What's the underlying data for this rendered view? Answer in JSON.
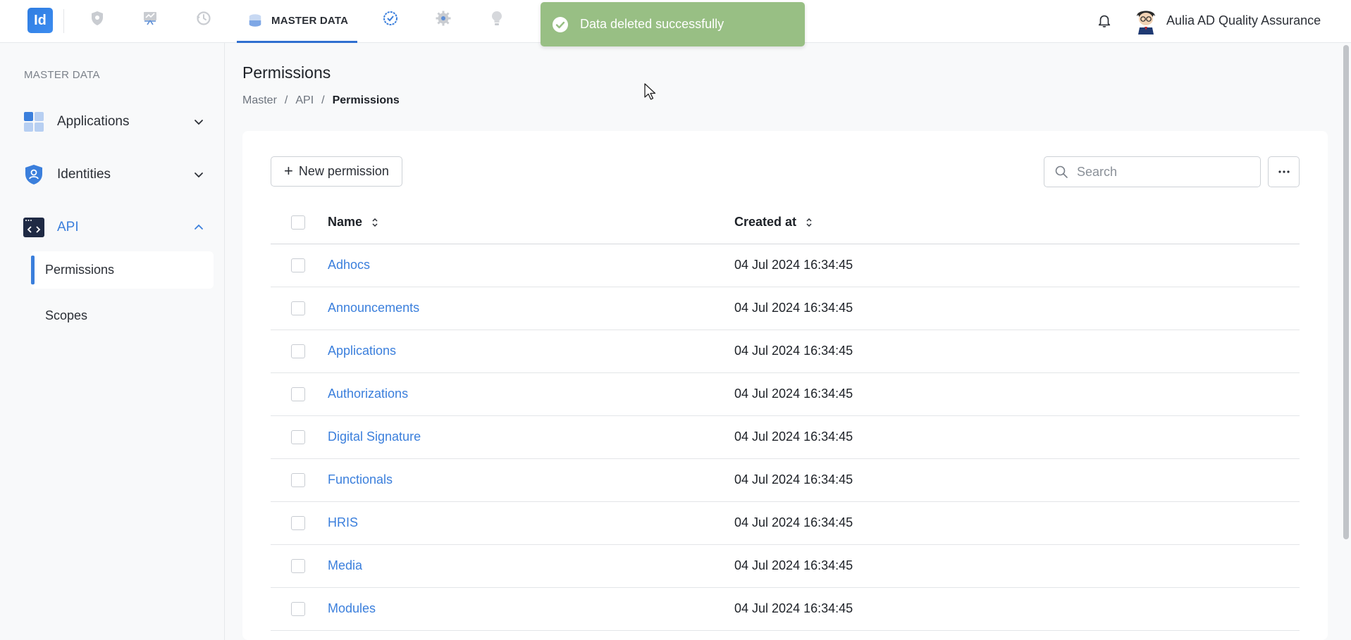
{
  "app": {
    "logo_text": "Id"
  },
  "topnav": {
    "active_tab_label": "MASTER DATA",
    "icons": [
      "shield-icon",
      "presentation-icon",
      "history-icon",
      "database-icon",
      "check-badge-icon",
      "gear-icon",
      "lightbulb-icon"
    ]
  },
  "user": {
    "name": "Aulia AD Quality Assurance"
  },
  "toast": {
    "message": "Data deleted successfully",
    "color": "#98bf84"
  },
  "sidebar": {
    "title": "MASTER DATA",
    "items": [
      {
        "label": "Applications",
        "icon": "grid-icon",
        "expanded": false
      },
      {
        "label": "Identities",
        "icon": "user-shield-icon",
        "expanded": false
      },
      {
        "label": "API",
        "icon": "code-window-icon",
        "expanded": true
      }
    ],
    "sub_items": [
      {
        "label": "Permissions",
        "active": true
      },
      {
        "label": "Scopes",
        "active": false
      }
    ]
  },
  "page": {
    "title": "Permissions",
    "breadcrumb": [
      "Master",
      "API",
      "Permissions"
    ]
  },
  "toolbar": {
    "new_label": "New permission",
    "search_placeholder": "Search"
  },
  "table": {
    "headers": [
      "Name",
      "Created at"
    ],
    "rows": [
      {
        "name": "Adhocs",
        "created": "04 Jul 2024 16:34:45"
      },
      {
        "name": "Announcements",
        "created": "04 Jul 2024 16:34:45"
      },
      {
        "name": "Applications",
        "created": "04 Jul 2024 16:34:45"
      },
      {
        "name": "Authorizations",
        "created": "04 Jul 2024 16:34:45"
      },
      {
        "name": "Digital Signature",
        "created": "04 Jul 2024 16:34:45"
      },
      {
        "name": "Functionals",
        "created": "04 Jul 2024 16:34:45"
      },
      {
        "name": "HRIS",
        "created": "04 Jul 2024 16:34:45"
      },
      {
        "name": "Media",
        "created": "04 Jul 2024 16:34:45"
      },
      {
        "name": "Modules",
        "created": "04 Jul 2024 16:34:45"
      }
    ]
  },
  "colors": {
    "accent": "#3b7fdc",
    "link": "#3b7fdc"
  }
}
